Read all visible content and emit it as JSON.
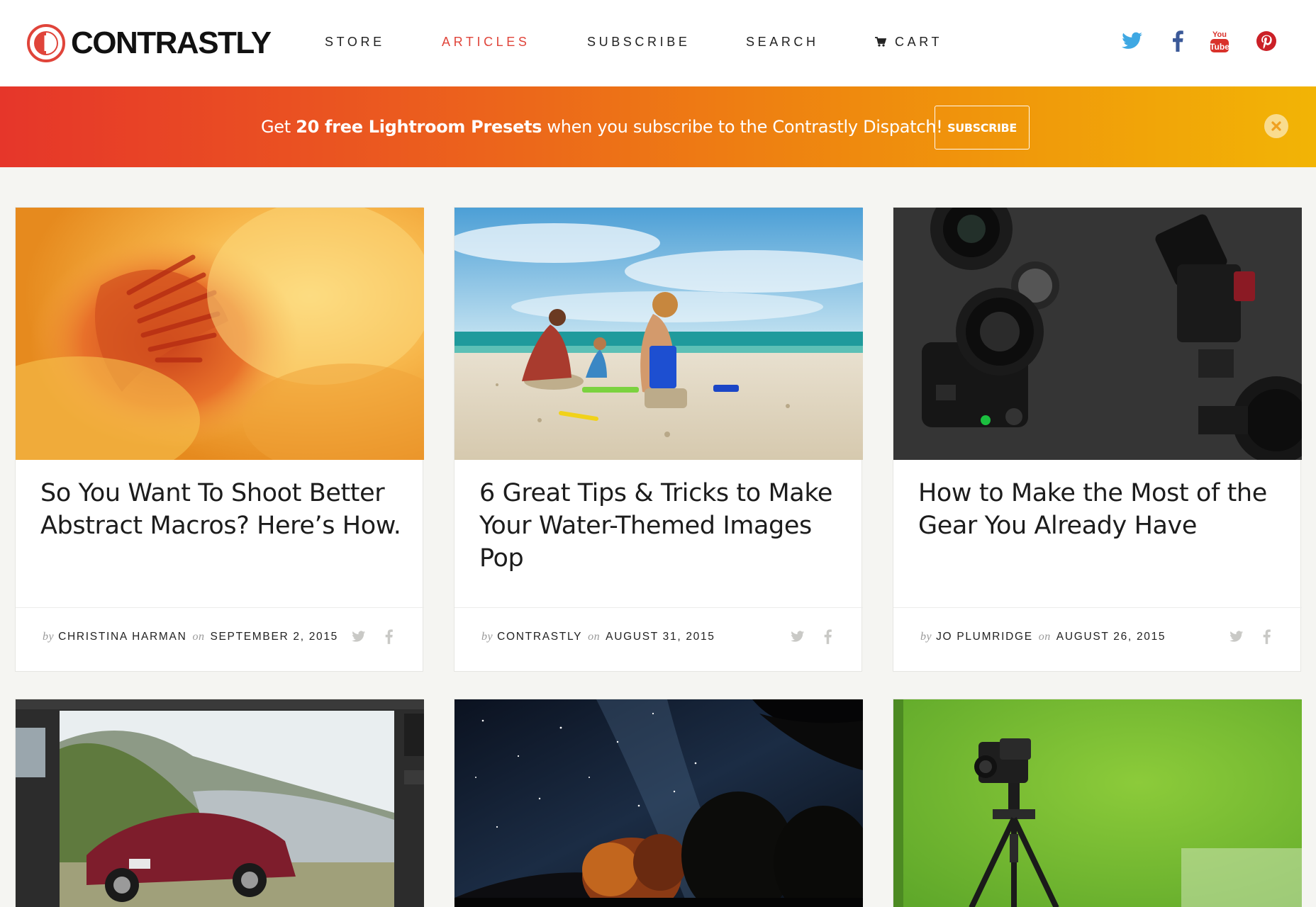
{
  "brand": {
    "name": "CONTRASTLY"
  },
  "nav": {
    "items": [
      {
        "label": "STORE",
        "active": false
      },
      {
        "label": "ARTICLES",
        "active": true
      },
      {
        "label": "SUBSCRIBE",
        "active": false
      },
      {
        "label": "SEARCH",
        "active": false
      },
      {
        "label": "CART",
        "active": false,
        "icon": "cart-icon"
      }
    ]
  },
  "social": [
    {
      "name": "twitter-icon",
      "color": "#3fa8e3"
    },
    {
      "name": "facebook-icon",
      "color": "#3b5998"
    },
    {
      "name": "youtube-icon",
      "color": "#d9322b"
    },
    {
      "name": "pinterest-icon",
      "color": "#cb2027"
    }
  ],
  "banner": {
    "text_before": "Get ",
    "text_bold": "20 free Lightroom Presets",
    "text_after": " when you subscribe to the Contrastly Dispatch!",
    "button_label": "SUBSCRIBE",
    "close_icon": "close-icon"
  },
  "meta_words": {
    "by": "by",
    "on": "on"
  },
  "articles": [
    {
      "title": "So You Want To Shoot Better Abstract Macros? Here’s How.",
      "author": "CHRISTINA HARMAN",
      "date": "SEPTEMBER 2, 2015",
      "image": "abstract-orange-flower-macro-photo"
    },
    {
      "title": "6 Great Tips & Tricks to Make Your Water-Themed Images Pop",
      "author": "CONTRASTLY",
      "date": "AUGUST 31, 2015",
      "image": "family-building-sandcastle-on-beach-photo"
    },
    {
      "title": "How to Make the Most of the Gear You Already Have",
      "author": "JO PLUMRIDGE",
      "date": "AUGUST 26, 2015",
      "image": "dslr-cameras-and-lenses-on-dark-table-photo"
    },
    {
      "image": "lightroom-editor-with-red-corvette-in-mountains-photo"
    },
    {
      "image": "milky-way-night-sky-over-autumn-trees-photo"
    },
    {
      "image": "video-camera-on-tripod-green-screen-photo"
    }
  ],
  "colors": {
    "accent": "#e0443a",
    "banner_start": "#e6362a",
    "banner_end": "#f2b405"
  }
}
